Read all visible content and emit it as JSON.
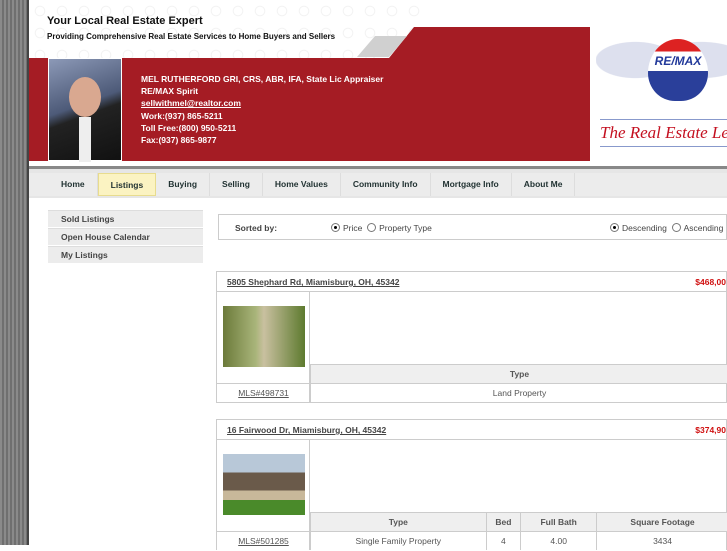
{
  "header": {
    "title": "Your Local Real Estate Expert",
    "subtitle": "Providing Comprehensive Real Estate Services to Home Buyers and Sellers"
  },
  "agent": {
    "name": "MEL RUTHERFORD GRI, CRS, ABR, IFA, State Lic Appraiser",
    "company": "RE/MAX Spirit",
    "email": "sellwithmel@realtor.com",
    "work": "Work:(937) 865-5211",
    "tollfree": "Toll Free:(800) 950-5211",
    "fax": "Fax:(937) 865-9877"
  },
  "logo": {
    "brand": "RE/MAX",
    "tagline": "The Real Estate Lead"
  },
  "nav": [
    "Home",
    "Listings",
    "Buying",
    "Selling",
    "Home Values",
    "Community Info",
    "Mortgage Info",
    "About Me"
  ],
  "sidebar": [
    "Sold Listings",
    "Open House Calendar",
    "My Listings"
  ],
  "sort": {
    "label": "Sorted by:",
    "price": "Price",
    "type": "Property Type",
    "desc": "Descending",
    "asc": "Ascending"
  },
  "listings": [
    {
      "address": "5805 Shephard Rd, Miamisburg, OH, 45342",
      "price": "$468,00",
      "mls": "MLS#498731",
      "headers": [
        "Type"
      ],
      "values": [
        "Land Property"
      ]
    },
    {
      "address": "16 Fairwood Dr, Miamisburg, OH, 45342",
      "price": "$374,90",
      "mls": "MLS#501285",
      "headers": [
        "Type",
        "Bed",
        "Full Bath",
        "Square Footage"
      ],
      "values": [
        "Single Family Property",
        "4",
        "4.00",
        "3434"
      ]
    }
  ],
  "colors": {
    "brand_red": "#a51c24",
    "price_red": "#d01010"
  }
}
